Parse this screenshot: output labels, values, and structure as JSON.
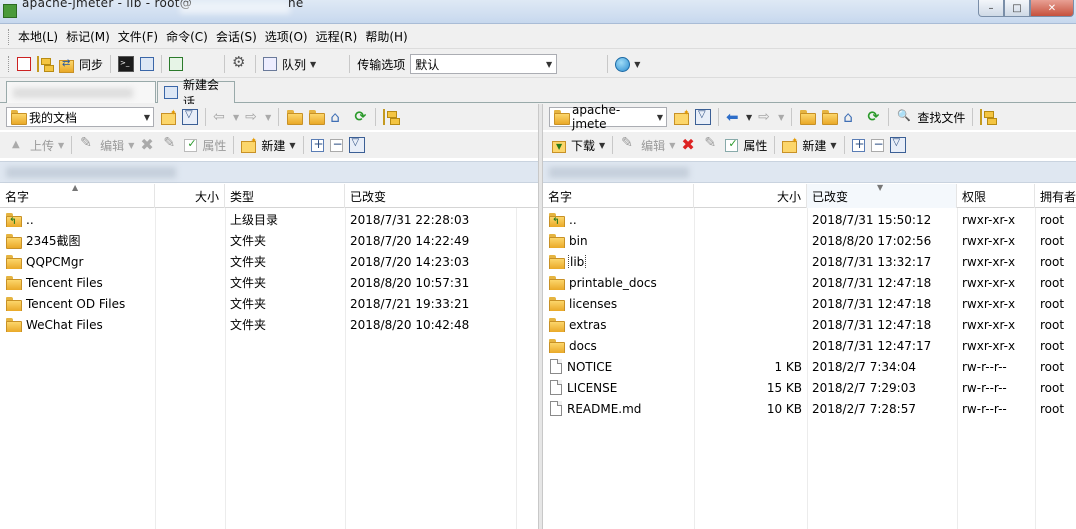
{
  "titlebar": {
    "title": "apache-jmeter - lib - root@",
    "title_suffix": "ne",
    "min": "–",
    "max": "□",
    "close": "✕"
  },
  "menu": [
    "本地(L)",
    "标记(M)",
    "文件(F)",
    "命令(C)",
    "会话(S)",
    "选项(O)",
    "远程(R)",
    "帮助(H)"
  ],
  "toolbar": {
    "sync_label": "同步",
    "queue_label": "队列",
    "transfer_label": "传输选项",
    "transfer_value": "默认"
  },
  "tabs": {
    "new_session": "新建会话"
  },
  "left": {
    "location": "我的文档",
    "toolbar": {
      "upload": "上传",
      "edit": "编辑",
      "properties": "属性",
      "new": "新建"
    },
    "columns": [
      "名字",
      "大小",
      "类型",
      "已改变"
    ],
    "rows": [
      {
        "name": "..",
        "size": "",
        "type": "上级目录",
        "changed": "2018/7/31  22:28:03",
        "icon": "updir-icon"
      },
      {
        "name": "2345截图",
        "size": "",
        "type": "文件夹",
        "changed": "2018/7/20  14:22:49",
        "icon": "folder-icon"
      },
      {
        "name": "QQPCMgr",
        "size": "",
        "type": "文件夹",
        "changed": "2018/7/20  14:23:03",
        "icon": "folder-icon"
      },
      {
        "name": "Tencent Files",
        "size": "",
        "type": "文件夹",
        "changed": "2018/8/20  10:57:31",
        "icon": "folder-icon"
      },
      {
        "name": "Tencent OD Files",
        "size": "",
        "type": "文件夹",
        "changed": "2018/7/21  19:33:21",
        "icon": "folder-icon"
      },
      {
        "name": "WeChat Files",
        "size": "",
        "type": "文件夹",
        "changed": "2018/8/20  10:42:48",
        "icon": "folder-icon"
      }
    ]
  },
  "right": {
    "location": "apache-jmete",
    "find_files": "查找文件",
    "toolbar": {
      "download": "下载",
      "edit": "编辑",
      "properties": "属性",
      "new": "新建"
    },
    "columns": [
      "名字",
      "大小",
      "已改变",
      "权限",
      "拥有者"
    ],
    "rows": [
      {
        "name": "..",
        "size": "",
        "changed": "2018/7/31 15:50:12",
        "perm": "rwxr-xr-x",
        "owner": "root",
        "icon": "updir-icon"
      },
      {
        "name": "bin",
        "size": "",
        "changed": "2018/8/20 17:02:56",
        "perm": "rwxr-xr-x",
        "owner": "root",
        "icon": "folder-icon"
      },
      {
        "name": "lib",
        "size": "",
        "changed": "2018/7/31 13:32:17",
        "perm": "rwxr-xr-x",
        "owner": "root",
        "icon": "folder-icon"
      },
      {
        "name": "printable_docs",
        "size": "",
        "changed": "2018/7/31 12:47:18",
        "perm": "rwxr-xr-x",
        "owner": "root",
        "icon": "folder-icon"
      },
      {
        "name": "licenses",
        "size": "",
        "changed": "2018/7/31 12:47:18",
        "perm": "rwxr-xr-x",
        "owner": "root",
        "icon": "folder-icon"
      },
      {
        "name": "extras",
        "size": "",
        "changed": "2018/7/31 12:47:18",
        "perm": "rwxr-xr-x",
        "owner": "root",
        "icon": "folder-icon"
      },
      {
        "name": "docs",
        "size": "",
        "changed": "2018/7/31 12:47:17",
        "perm": "rwxr-xr-x",
        "owner": "root",
        "icon": "folder-icon"
      },
      {
        "name": "NOTICE",
        "size": "1 KB",
        "changed": "2018/2/7 7:34:04",
        "perm": "rw-r--r--",
        "owner": "root",
        "icon": "file-icon"
      },
      {
        "name": "LICENSE",
        "size": "15 KB",
        "changed": "2018/2/7 7:29:03",
        "perm": "rw-r--r--",
        "owner": "root",
        "icon": "file-icon"
      },
      {
        "name": "README.md",
        "size": "10 KB",
        "changed": "2018/2/7 7:28:57",
        "perm": "rw-r--r--",
        "owner": "root",
        "icon": "file-icon"
      }
    ]
  }
}
